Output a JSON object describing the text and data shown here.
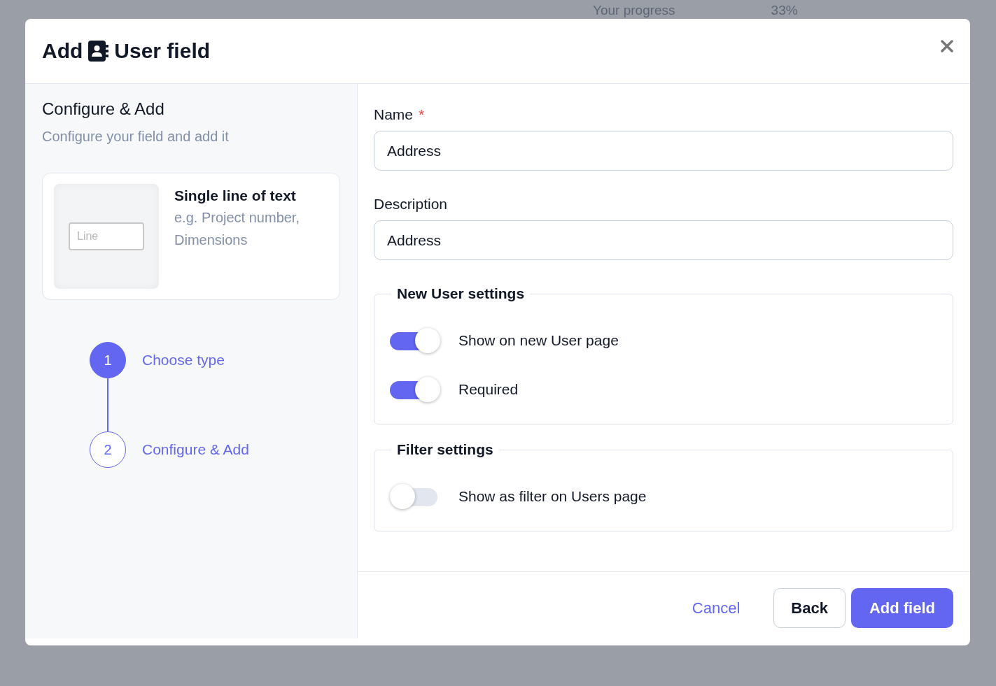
{
  "background": {
    "progress_label": "Your progress",
    "progress_value": "33%"
  },
  "dialog": {
    "title_prefix": "Add",
    "title_suffix": "User field"
  },
  "intro": {
    "title": "Configure & Add",
    "subtitle": "Configure your field and add it"
  },
  "field_type": {
    "preview_placeholder": "Line",
    "title": "Single line of text",
    "example": "e.g. Project number, Dimensions"
  },
  "steps": [
    {
      "number": "1",
      "label": "Choose type",
      "completed": true
    },
    {
      "number": "2",
      "label": "Configure & Add",
      "completed": false
    }
  ],
  "name_field": {
    "label": "Name",
    "required_mark": "*",
    "value": "Address"
  },
  "description_field": {
    "label": "Description",
    "value": "Address"
  },
  "groups": [
    {
      "legend": "New User settings",
      "toggles": [
        {
          "label": "Show on new User page",
          "on": true
        },
        {
          "label": "Required",
          "on": true
        }
      ]
    },
    {
      "legend": "Filter settings",
      "toggles": [
        {
          "label": "Show as filter on Users page",
          "on": false
        }
      ]
    }
  ],
  "buttons": [
    {
      "label": "Cancel",
      "kind": "link"
    },
    {
      "label": "Back",
      "kind": "secondary"
    },
    {
      "label": "Add field",
      "kind": "primary"
    }
  ]
}
